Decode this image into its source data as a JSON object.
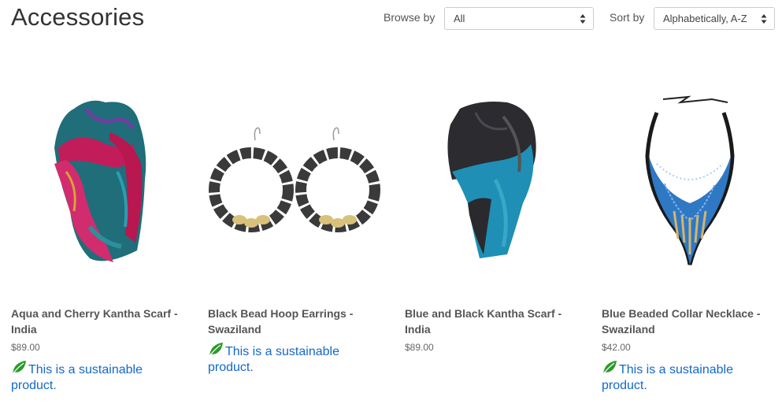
{
  "page": {
    "title": "Accessories"
  },
  "filters": {
    "browse_label": "Browse by",
    "browse_value": "All",
    "sort_label": "Sort by",
    "sort_value": "Alphabetically, A-Z"
  },
  "products": [
    {
      "name": "Aqua and Cherry Kantha Scarf - India",
      "price": "$89.00",
      "sustainable": "This is a sustainable product."
    },
    {
      "name": "Black Bead Hoop Earrings - Swaziland",
      "price": "",
      "sustainable": "This is a sustainable product."
    },
    {
      "name": "Blue and Black Kantha Scarf - India",
      "price": "$89.00",
      "sustainable": ""
    },
    {
      "name": "Blue Beaded Collar Necklace - Swaziland",
      "price": "$42.00",
      "sustainable": "This is a sustainable product."
    }
  ],
  "icons": {
    "leaf": "leaf-icon",
    "select_arrows": "updown-arrows-icon"
  },
  "colors": {
    "link": "#1468c9",
    "leaf": "#2a9a2a"
  }
}
